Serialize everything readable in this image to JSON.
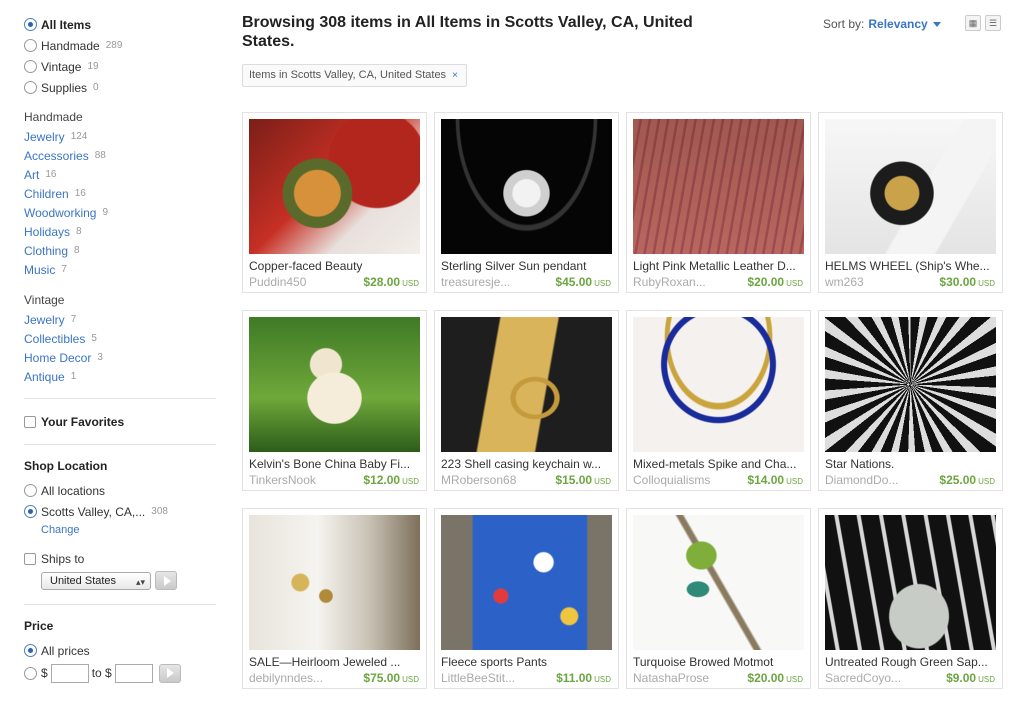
{
  "sidebar": {
    "top_filters": [
      {
        "label": "All Items",
        "count": "",
        "selected": true
      },
      {
        "label": "Handmade",
        "count": "289",
        "selected": false
      },
      {
        "label": "Vintage",
        "count": "19",
        "selected": false
      },
      {
        "label": "Supplies",
        "count": "0",
        "selected": false
      }
    ],
    "handmade": {
      "heading": "Handmade",
      "items": [
        {
          "label": "Jewelry",
          "count": "124"
        },
        {
          "label": "Accessories",
          "count": "88"
        },
        {
          "label": "Art",
          "count": "16"
        },
        {
          "label": "Children",
          "count": "16"
        },
        {
          "label": "Woodworking",
          "count": "9"
        },
        {
          "label": "Holidays",
          "count": "8"
        },
        {
          "label": "Clothing",
          "count": "8"
        },
        {
          "label": "Music",
          "count": "7"
        }
      ]
    },
    "vintage": {
      "heading": "Vintage",
      "items": [
        {
          "label": "Jewelry",
          "count": "7"
        },
        {
          "label": "Collectibles",
          "count": "5"
        },
        {
          "label": "Home Decor",
          "count": "3"
        },
        {
          "label": "Antique",
          "count": "1"
        }
      ]
    },
    "favorites_label": "Your Favorites",
    "shop_location": {
      "heading": "Shop Location",
      "all_label": "All locations",
      "selected_label": "Scotts Valley, CA,...",
      "selected_count": "308",
      "change_link": "Change"
    },
    "ships_to": {
      "label": "Ships to",
      "country": "United States"
    },
    "price": {
      "heading": "Price",
      "all_label": "All prices",
      "currency": "$",
      "to_label": "to $"
    }
  },
  "header": {
    "title": "Browsing 308 items in All Items in Scotts Valley, CA, United States.",
    "sort_label": "Sort by:",
    "sort_value": "Relevancy",
    "filter_tag": "Items in Scotts Valley, CA, United States",
    "filter_tag_remove": "×"
  },
  "listings": [
    {
      "title": "Copper-faced Beauty",
      "shop": "Puddin450",
      "price": "$28.00",
      "currency": "USD"
    },
    {
      "title": "Sterling Silver Sun pendant",
      "shop": "treasuresje...",
      "price": "$45.00",
      "currency": "USD"
    },
    {
      "title": "Light Pink Metallic Leather D...",
      "shop": "RubyRoxan...",
      "price": "$20.00",
      "currency": "USD"
    },
    {
      "title": "HELMS WHEEL (Ship's Whe...",
      "shop": "wm263",
      "price": "$30.00",
      "currency": "USD"
    },
    {
      "title": "Kelvin's Bone China Baby Fi...",
      "shop": "TinkersNook",
      "price": "$12.00",
      "currency": "USD"
    },
    {
      "title": "223 Shell casing keychain w...",
      "shop": "MRoberson68",
      "price": "$15.00",
      "currency": "USD"
    },
    {
      "title": "Mixed-metals Spike and Cha...",
      "shop": "Colloquialisms",
      "price": "$14.00",
      "currency": "USD"
    },
    {
      "title": "Star Nations.",
      "shop": "DiamondDo...",
      "price": "$25.00",
      "currency": "USD"
    },
    {
      "title": "SALE—Heirloom Jeweled ...",
      "shop": "debilynndes...",
      "price": "$75.00",
      "currency": "USD"
    },
    {
      "title": "Fleece sports Pants",
      "shop": "LittleBeeStit...",
      "price": "$11.00",
      "currency": "USD"
    },
    {
      "title": "Turquoise Browed Motmot",
      "shop": "NatashaProse",
      "price": "$20.00",
      "currency": "USD"
    },
    {
      "title": "Untreated Rough Green Sap...",
      "shop": "SacredCoyo...",
      "price": "$9.00",
      "currency": "USD"
    }
  ],
  "colors": {
    "link": "#3a75c4",
    "price": "#6ca542",
    "muted": "#aaaaaa"
  }
}
